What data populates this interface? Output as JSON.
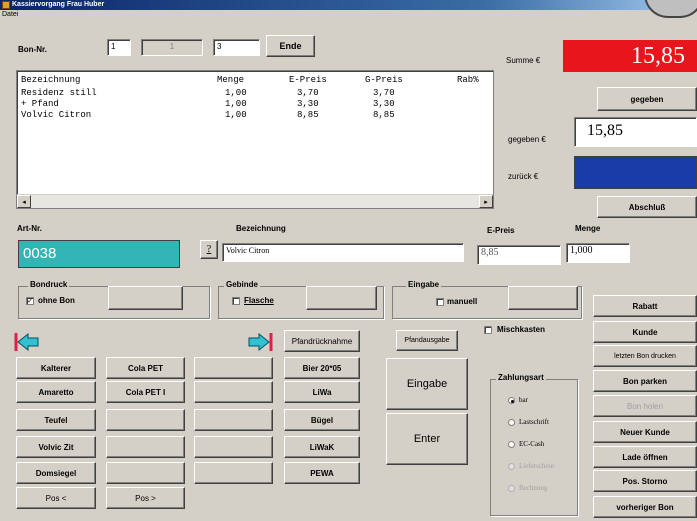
{
  "window": {
    "title": "Kassiervorgang Frau Huber",
    "menu": "Datei"
  },
  "header": {
    "bon_label": "Bon-Nr.",
    "bon_field1": "1",
    "bon_field2": "1",
    "bon_field3": "3",
    "ende_button": "Ende"
  },
  "table": {
    "headers": [
      "Bezeichnung",
      "Menge",
      "E-Preis",
      "G-Preis",
      "Rab%"
    ],
    "rows": [
      [
        "Residenz still",
        "1,00",
        "3,70",
        "3,70",
        ""
      ],
      [
        "+ Pfand",
        "1,00",
        "3,30",
        "3,30",
        ""
      ],
      [
        "Volvic Citron",
        "1,00",
        "8,85",
        "8,85",
        ""
      ]
    ]
  },
  "summary": {
    "summe_label": "Summe €",
    "summe_value": "15,85",
    "gegeben_button": "gegeben",
    "gegeben_label": "gegeben €",
    "gegeben_value": "15,85",
    "zurueck_label": "zurück €",
    "zurueck_value": "",
    "abschluss_button": "Abschluß",
    "summe_color": "#e8151c",
    "zurueck_color": "#1a3ca8"
  },
  "article": {
    "artnr_label": "Art-Nr.",
    "artnr_value": "0038",
    "help_button": "?",
    "bezeichnung_label": "Bezeichnung",
    "bezeichnung_value": "Volvic Citron",
    "epreis_label": "E-Preis",
    "epreis_value": "8,85",
    "menge_label": "Menge",
    "menge_value": "1,000",
    "artnr_color": "#33b5b5"
  },
  "groups": {
    "bondruck_title": "Bondruck",
    "ohne_bon": "ohne Bon",
    "ohne_bon_checked": true,
    "gebinde_title": "Gebinde",
    "flasche": "Flasche",
    "flasche_checked": false,
    "eingabe_title": "Eingabe",
    "manuell": "manuell",
    "manuell_checked": false,
    "mischkasten": "Mischkasten",
    "mischkasten_checked": false
  },
  "quick_buttons": {
    "col1": [
      "Kalterer",
      "Amaretto",
      "Teufel",
      "Volvic Zit",
      "Domsiegel",
      "Pos <"
    ],
    "col2": [
      "Cola PET",
      "Cola PET I",
      "",
      "",
      "",
      "Pos >"
    ],
    "col3": [
      "",
      "",
      "",
      "",
      ""
    ],
    "col4": [
      "Pfandrücknahme",
      "Bier 20*05",
      "LiWa",
      "Bügel",
      "LiWaK",
      "PEWA"
    ]
  },
  "center": {
    "pfandausgabe": "Pfandausgabe",
    "eingabe": "Eingabe",
    "enter": "Enter"
  },
  "zahlungsart": {
    "title": "Zahlungsart",
    "options": [
      "bar",
      "Lastschrift",
      "EC-Cash",
      "Lieferschein",
      "Rechnung"
    ],
    "selected": 0
  },
  "right_buttons": [
    "Rabatt",
    "Kunde",
    "letzten Bon drucken",
    "Bon parken",
    "Bon holen",
    "Neuer Kunde",
    "Lade öffnen",
    "Pos. Storno",
    "vorheriger Bon"
  ]
}
